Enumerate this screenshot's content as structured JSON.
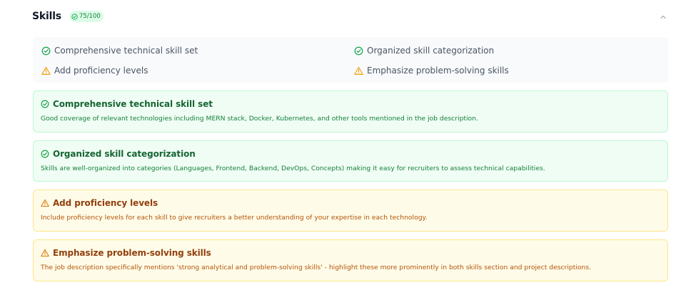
{
  "section": {
    "title": "Skills",
    "score": "75/100",
    "collapse_icon": "chevron-up-icon"
  },
  "colors": {
    "strength_accent": "#16a34a",
    "improvement_accent": "#f59e0b",
    "strength_bg": "#f0fdf4",
    "improvement_bg": "#fefce8"
  },
  "summary": {
    "items": [
      {
        "label": "Comprehensive technical skill set",
        "kind": "strength",
        "icon": "check-circle-icon"
      },
      {
        "label": "Organized skill categorization",
        "kind": "strength",
        "icon": "check-circle-icon"
      },
      {
        "label": "Add proficiency levels",
        "kind": "improvement",
        "icon": "warning-triangle-icon"
      },
      {
        "label": "Emphasize problem-solving skills",
        "kind": "improvement",
        "icon": "warning-triangle-icon"
      }
    ]
  },
  "cards": [
    {
      "kind": "strength",
      "icon": "check-circle-icon",
      "title": "Comprehensive technical skill set",
      "description": "Good coverage of relevant technologies including MERN stack, Docker, Kubernetes, and other tools mentioned in the job description."
    },
    {
      "kind": "strength",
      "icon": "check-circle-icon",
      "title": "Organized skill categorization",
      "description": "Skills are well-organized into categories (Languages, Frontend, Backend, DevOps, Concepts) making it easy for recruiters to assess technical capabilities."
    },
    {
      "kind": "improvement",
      "icon": "warning-triangle-icon",
      "title": "Add proficiency levels",
      "description": "Include proficiency levels for each skill to give recruiters a better understanding of your expertise in each technology."
    },
    {
      "kind": "improvement",
      "icon": "warning-triangle-icon",
      "title": "Emphasize problem-solving skills",
      "description": "The job description specifically mentions 'strong analytical and problem-solving skills' - highlight these more prominently in both skills section and project descriptions."
    }
  ]
}
